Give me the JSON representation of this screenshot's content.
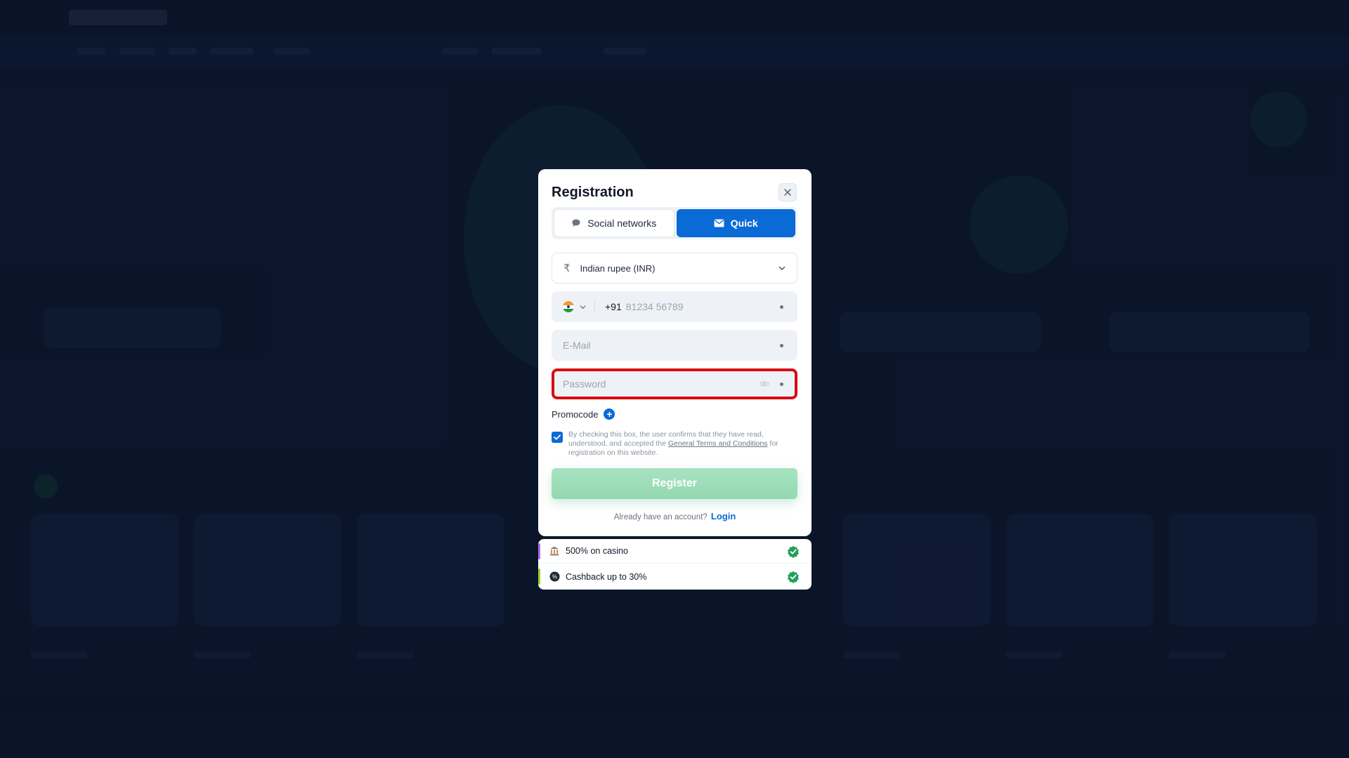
{
  "modal": {
    "title": "Registration",
    "tabs": [
      {
        "label": "Social networks",
        "active": false,
        "icon": "chat-bubble-icon"
      },
      {
        "label": "Quick",
        "active": true,
        "icon": "envelope-icon"
      }
    ],
    "currency": {
      "icon": "rupee-icon",
      "value": "Indian rupee (INR)"
    },
    "phone": {
      "country_code": "+91",
      "placeholder": "81234 56789"
    },
    "email": {
      "placeholder": "E-Mail"
    },
    "password": {
      "placeholder": "Password"
    },
    "promocode_label": "Promocode",
    "consent": {
      "checked": true,
      "text_before": "By checking this box, the user confirms that they have read, understood, and accepted the ",
      "link_text": "General Terms and Conditions",
      "text_after": " for registration on this website."
    },
    "register_label": "Register",
    "already_text": "Already have an account?",
    "login_label": "Login"
  },
  "bonuses": [
    {
      "label": "500% on casino",
      "accent": "#b469e0",
      "icon": "casino-icon"
    },
    {
      "label": "Cashback up to 30%",
      "accent": "#9ccc2c",
      "icon": "cashback-icon"
    }
  ],
  "colors": {
    "accent": "#0a6ad6",
    "error_border": "#d80d12",
    "register_bg": "#9fdfba",
    "check_green": "#21a05a"
  }
}
